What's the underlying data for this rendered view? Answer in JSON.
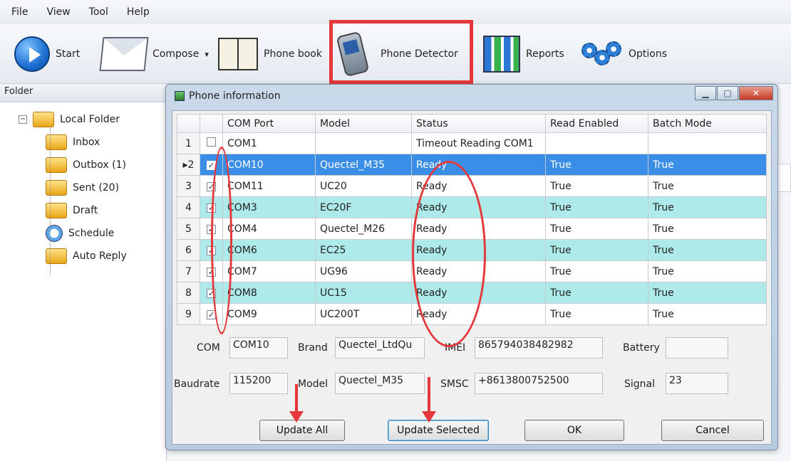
{
  "menu": [
    "File",
    "View",
    "Tool",
    "Help"
  ],
  "toolbar": {
    "start": "Start",
    "compose": "Compose",
    "phone_book": "Phone book",
    "phone_detector": "Phone Detector",
    "reports": "Reports",
    "options": "Options"
  },
  "folder_pane": {
    "header": "Folder",
    "root": "Local Folder",
    "items": [
      "Inbox",
      "Outbox (1)",
      "Sent (20)",
      "Draft",
      "Schedule",
      "Auto Reply"
    ]
  },
  "dialog": {
    "title": "Phone information",
    "columns": [
      "COM Port",
      "Model",
      "Status",
      "Read Enabled",
      "Batch Mode"
    ],
    "rows": [
      {
        "num": "1",
        "checked": false,
        "com": "COM1",
        "model": "",
        "status": "Timeout Reading COM1",
        "read": "",
        "batch": "",
        "style": "plain"
      },
      {
        "num": "2",
        "checked": true,
        "com": "COM10",
        "model": "Quectel_M35",
        "status": "Ready",
        "read": "True",
        "batch": "True",
        "style": "selected"
      },
      {
        "num": "3",
        "checked": true,
        "com": "COM11",
        "model": "UC20",
        "status": "Ready",
        "read": "True",
        "batch": "True",
        "style": "plain"
      },
      {
        "num": "4",
        "checked": true,
        "com": "COM3",
        "model": "EC20F",
        "status": "Ready",
        "read": "True",
        "batch": "True",
        "style": "teal"
      },
      {
        "num": "5",
        "checked": true,
        "com": "COM4",
        "model": "Quectel_M26",
        "status": "Ready",
        "read": "True",
        "batch": "True",
        "style": "plain"
      },
      {
        "num": "6",
        "checked": true,
        "com": "COM6",
        "model": "EC25",
        "status": "Ready",
        "read": "True",
        "batch": "True",
        "style": "teal"
      },
      {
        "num": "7",
        "checked": true,
        "com": "COM7",
        "model": "UG96",
        "status": "Ready",
        "read": "True",
        "batch": "True",
        "style": "plain"
      },
      {
        "num": "8",
        "checked": true,
        "com": "COM8",
        "model": "UC15",
        "status": "Ready",
        "read": "True",
        "batch": "True",
        "style": "teal"
      },
      {
        "num": "9",
        "checked": true,
        "com": "COM9",
        "model": "UC200T",
        "status": "Ready",
        "read": "True",
        "batch": "True",
        "style": "plain"
      }
    ],
    "details": {
      "com_label": "COM",
      "com_value": "COM10",
      "brand_label": "Brand",
      "brand_value": "Quectel_LtdQu",
      "imei_label": "IMEI",
      "imei_value": "865794038482982",
      "battery_label": "Battery",
      "battery_value": "",
      "baudrate_label": "Baudrate",
      "baudrate_value": "115200",
      "model_label": "Model",
      "model_value": "Quectel_M35",
      "smsc_label": "SMSC",
      "smsc_value": "+8613800752500",
      "signal_label": "Signal",
      "signal_value": "23"
    },
    "buttons": {
      "update_all": "Update All",
      "update_selected": "Update Selected",
      "ok": "OK",
      "cancel": "Cancel"
    }
  },
  "colors": {
    "annotation": "#e5383b",
    "selected_row": "#3a8ee6",
    "alt_row": "#aeeaea"
  }
}
